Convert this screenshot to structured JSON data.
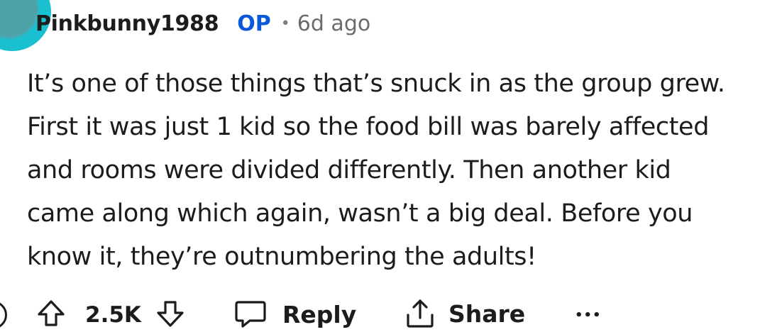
{
  "comment": {
    "username": "Pinkbunny1988",
    "op_badge": "OP",
    "separator": "•",
    "timestamp": "6d ago",
    "body_lines": [
      "It’s one of those things that’s snuck in as the group grew.",
      "First it was just 1 kid so the food bill was barely affected",
      "and rooms were divided differently. Then another kid",
      "came along which again, wasn’t a big deal. Before you",
      "know it, they’re outnumbering the adults!"
    ]
  },
  "actions": {
    "vote_count": "2.5K",
    "reply_label": "Reply",
    "share_label": "Share",
    "more_label": "•••"
  },
  "colors": {
    "op_badge": "#0a59d8",
    "avatar": "#19c0cf",
    "text": "#1c1c1c",
    "muted": "#6b6b6b"
  },
  "icons": [
    "avatar",
    "upvote-arrow-icon",
    "downvote-arrow-icon",
    "comment-bubble-icon",
    "share-upload-icon",
    "more-options-icon"
  ]
}
